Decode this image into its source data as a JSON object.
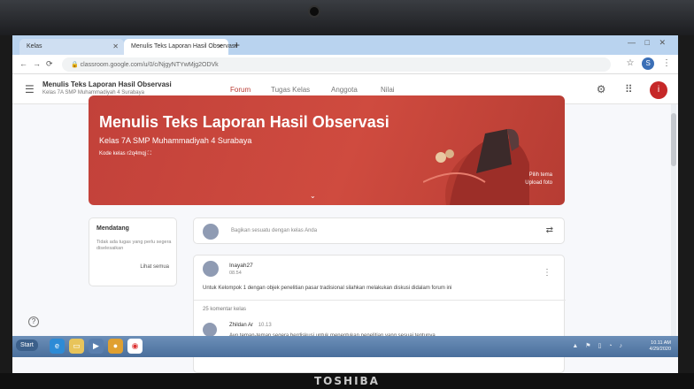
{
  "device": {
    "brand": "TOSHIBA"
  },
  "browser": {
    "tabs": [
      {
        "label": "Kelas"
      },
      {
        "label": "Menulis Teks Laporan Hasil Observasi"
      }
    ],
    "new_tab": "+",
    "window_controls": "— □ ✕",
    "url": "classroom.google.com/u/0/c/NjgyNTYwMjg2ODVk"
  },
  "classroom": {
    "class_name": "Menulis Teks Laporan Hasil Observasi",
    "class_section": "Kelas 7A SMP Muhammadiyah 4 Surabaya",
    "nav_tabs": [
      "Forum",
      "Tugas Kelas",
      "Anggota",
      "Nilai"
    ],
    "banner": {
      "title": "Menulis Teks Laporan Hasil Observasi",
      "subtitle": "Kelas 7A SMP Muhammadiyah 4 Surabaya",
      "class_code": "Kode kelas r2q4mqj ⛶",
      "pilih_tema": "Pilih tema",
      "upload_foto": "Upload foto"
    },
    "upcoming": {
      "title": "Mendatang",
      "empty_text": "Tidak ada tugas yang perlu segera diselesaikan",
      "view_all": "Lihat semua"
    },
    "share_placeholder": "Bagikan sesuatu dengan kelas Anda",
    "post": {
      "author": "Inayah27",
      "time": "08.54",
      "text": "Untuk Kelompok 1 dengan objek penelitian pasar tradisional silahkan melakukan diskusi didalam forum ini",
      "comment_count": "25 komentar kelas",
      "comment": {
        "author": "Zhildan Ar",
        "time": "10.13",
        "text": "Ayo teman-teman segera berdiskusi untuk menentukan penelitian yang sesuai tentunya"
      }
    },
    "help": "?"
  },
  "taskbar": {
    "start": "Start",
    "time": "10.11 AM",
    "date": "4/29/2020"
  }
}
